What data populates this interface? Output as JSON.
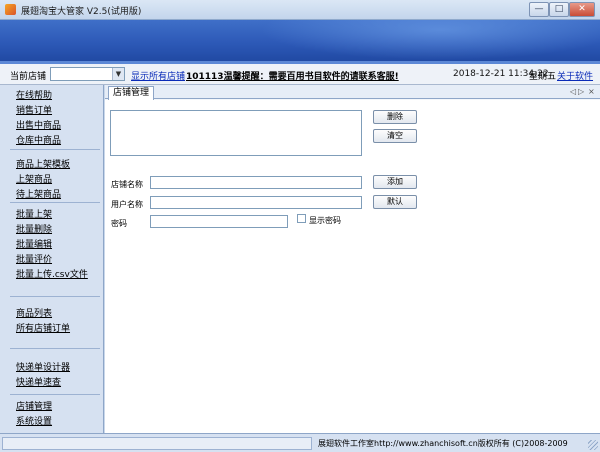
{
  "window": {
    "title": "展翅淘宝大管家 V2.5(试用版)",
    "minimize_glyph": "—",
    "maximize_glyph": "□",
    "close_glyph": "✕"
  },
  "toolbar": {
    "shop_label": "当前店铺",
    "shop_select_value": "",
    "show_all_link": "显示所有店铺",
    "notice": "101113温馨提醒：需要百用书目软件的请联系客服!",
    "datetime": "2018-12-21  11:34:22",
    "weekday": "星期五",
    "about_link": "关于软件"
  },
  "sidebar": {
    "groups": [
      [
        "在线帮助",
        "销售订单",
        "出售中商品",
        "仓库中商品"
      ],
      [
        "商品上架模板",
        "上架商品",
        "待上架商品"
      ],
      [
        "批量上架",
        "批量删除",
        "批量编辑",
        "批量评价",
        "批量上传.csv文件"
      ],
      [
        "商品列表",
        "所有店铺订单"
      ],
      [
        "快递单设计器",
        "快递单速查"
      ],
      [
        "店铺管理",
        "系统设置"
      ]
    ]
  },
  "tabs": {
    "active_label": "店铺管理",
    "nav_prev": "◁",
    "nav_next": "▷",
    "nav_close": "×"
  },
  "form": {
    "delete_button": "删除",
    "clear_button": "清空",
    "shop_name_label": "店铺名称",
    "shop_name_value": "",
    "username_label": "用户名称",
    "username_value": "",
    "password_label": "密码",
    "password_value": "",
    "add_button": "添加",
    "default_button": "默认",
    "show_password_label": "显示密码"
  },
  "statusbar": {
    "copyright": "展翅软件工作室http://www.zhanchisoft.cn版权所有 (C)2008-2009"
  },
  "colors": {
    "banner": "#2c58b6",
    "link": "#0a2bb8",
    "sidebar": "#d6e1f1"
  }
}
